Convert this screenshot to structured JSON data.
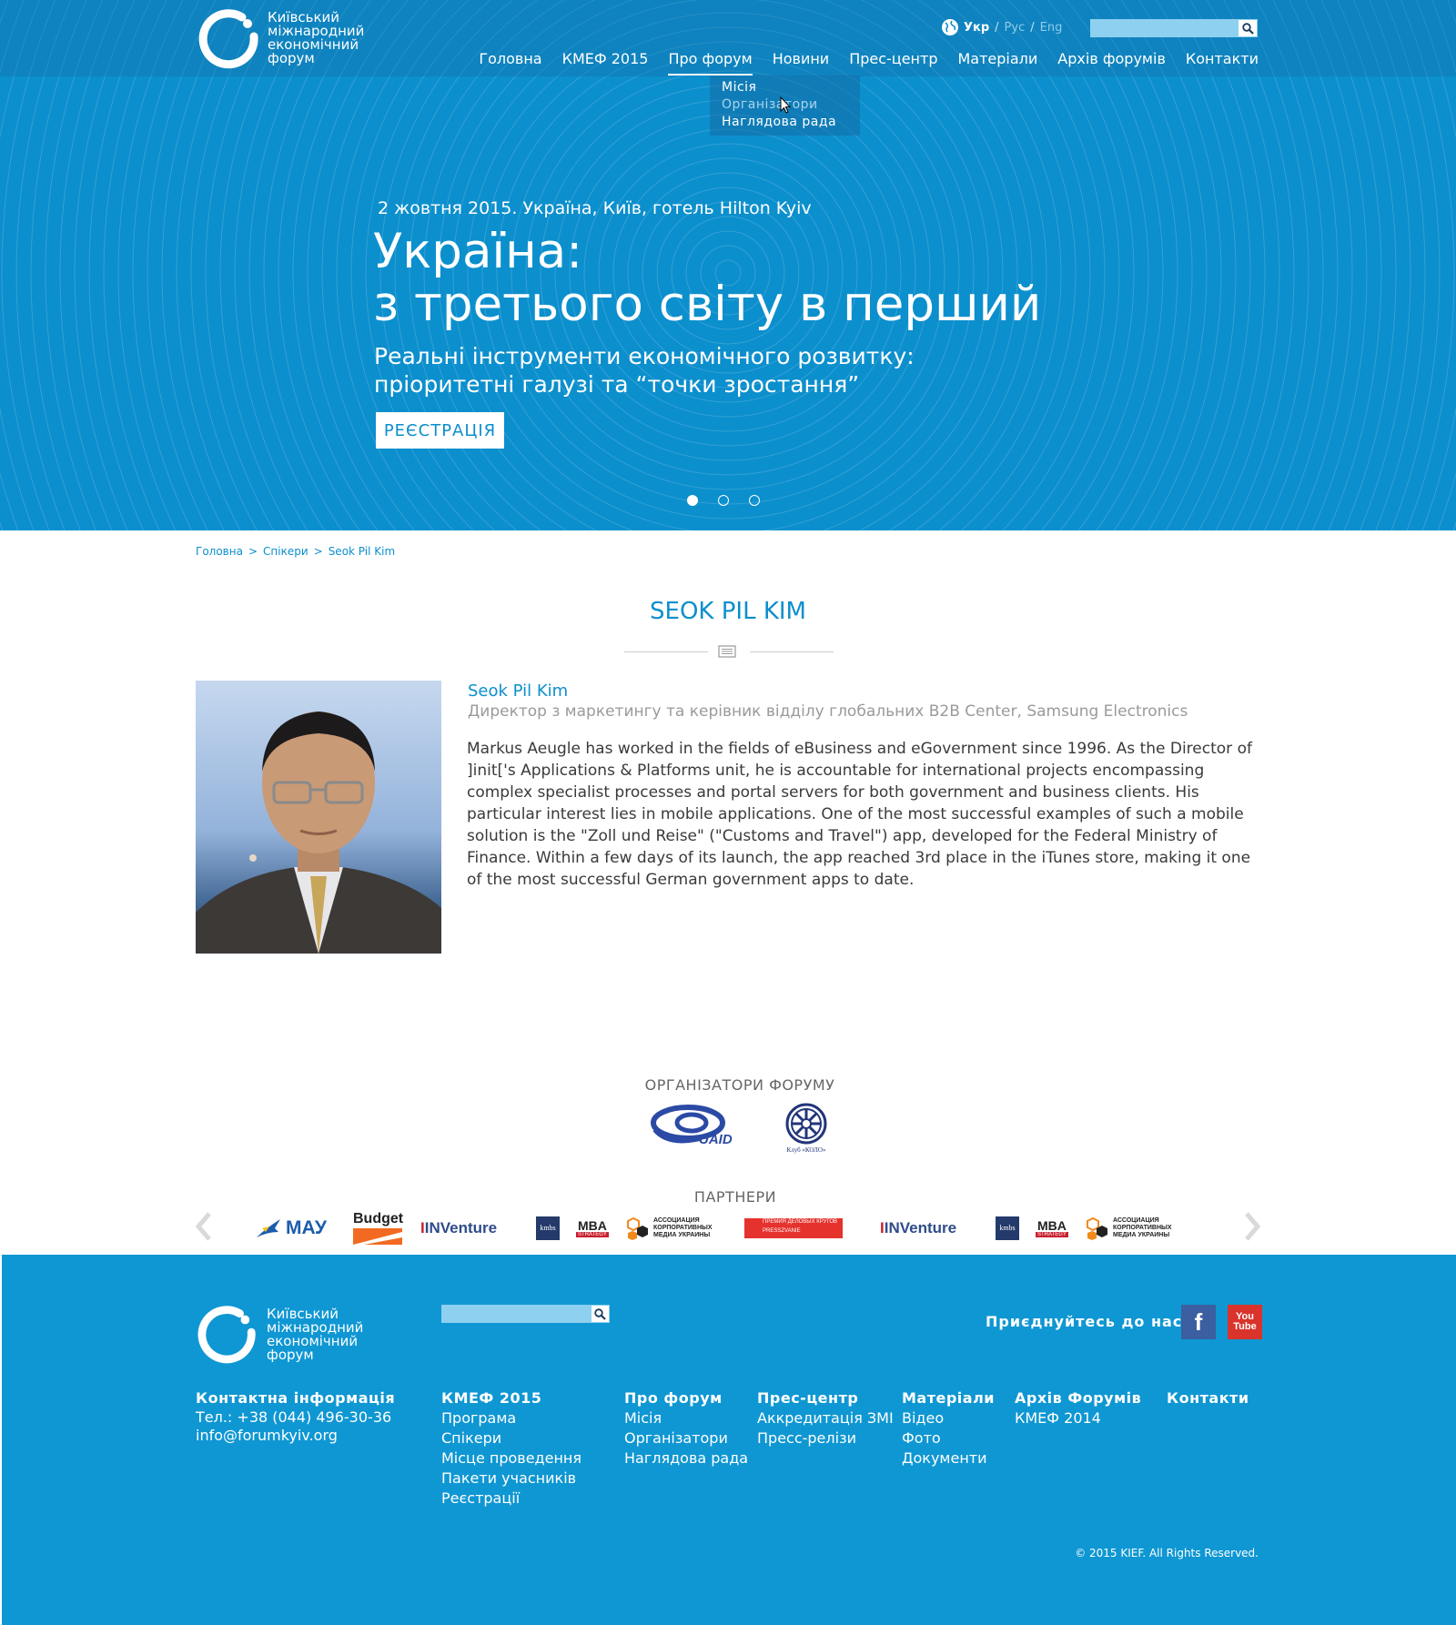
{
  "site": {
    "logo_lines": [
      "Київський",
      "міжнародний",
      "економічний",
      "форум"
    ]
  },
  "colors": {
    "brand": "#0c8fcd",
    "footer": "#0f97d3",
    "facebook": "#3b5fa0",
    "youtube": "#d9332b"
  },
  "header": {
    "languages": [
      "Укр",
      "Рус",
      "Eng"
    ],
    "active_language": "Укр",
    "search_placeholder": "",
    "nav": [
      "Головна",
      "КМЕФ 2015",
      "Про форум",
      "Новини",
      "Прес-центр",
      "Матеріали",
      "Архів форумів",
      "Контакти"
    ],
    "active_nav": "Про форум",
    "dropdown": [
      "Місія",
      "Організатори",
      "Наглядова рада"
    ]
  },
  "hero": {
    "date_line": "2 жовтня 2015. Україна, Київ, готель Hilton Kyiv",
    "title_lines": [
      "Україна:",
      "з третього світу в перший"
    ],
    "subtitle_lines": [
      "Реальні інструменти економічного розвитку:",
      "пріоритетні галузі та “точки зростання”"
    ],
    "register_label": "РЕЄСТРАЦІЯ",
    "slides_count": 3,
    "active_slide": 1
  },
  "breadcrumb": [
    "Головна",
    "Спікери",
    "Seok Pil Kim"
  ],
  "page_title": "SEOK PIL KIM",
  "speaker": {
    "name": "Seok Pil Kim",
    "role": "Директор з маркетингу та керівник відділу глобальних B2B Center, Samsung Electronics",
    "bio": "Markus Aeugle has worked in the fields of eBusiness and eGovernment since 1996. As the Director of ]init['s Applications & Platforms unit, he is accountable for international projects encompassing complex specialist processes and portal servers for both government and business clients. His particular interest lies in mobile applications. One of the most successful examples of such a mobile solution is the \"Zoll und Reise\" (\"Customs and Travel\") app, developed for the Federal Ministry of Finance. Within a few days of its launch, the app reached 3rd place in the iTunes store, making it one of the most successful German government apps to date."
  },
  "organizers": {
    "title": "ОРГАНІЗАТОРИ ФОРУМУ",
    "logos": [
      {
        "name": "UAID",
        "text": "UAID"
      },
      {
        "name": "Клуб КОЛО",
        "text": "Клуб «КОЛО»"
      }
    ]
  },
  "partners": {
    "title": "ПАРТНЕРИ",
    "logos": [
      {
        "id": "mau",
        "text": "МАУ"
      },
      {
        "id": "budget",
        "text": "Budget"
      },
      {
        "id": "inventure",
        "text": "INVenture"
      },
      {
        "id": "kmbs",
        "text": "kmbs"
      },
      {
        "id": "mba",
        "text": "MBA",
        "sub": "STRATEGY"
      },
      {
        "id": "akmu",
        "text": "АССОЦИАЦИЯ КОРПОРАТИВНЫХ МЕДИА УКРАИНЫ"
      },
      {
        "id": "premia",
        "text": "ПРЕМИЯ ДЕЛОВЫХ КРУГОВ",
        "sub": "PRESSZVANIE"
      },
      {
        "id": "inventure2",
        "text": "INVenture"
      },
      {
        "id": "kmbs2",
        "text": "kmbs"
      },
      {
        "id": "mba2",
        "text": "MBA",
        "sub": "STRATEGY"
      },
      {
        "id": "akmu2",
        "text": "АССОЦИАЦИЯ КОРПОРАТИВНЫХ МЕДИА УКРАИНЫ"
      }
    ]
  },
  "footer": {
    "join_label": "Приєднуйтесь до нас:",
    "social": {
      "facebook": "f",
      "youtube_top": "You",
      "youtube_bottom": "Tube"
    },
    "contact": {
      "heading": "Контактна  інформація",
      "phone": "Тел.: +38 (044) 496-30-36",
      "email": "info@forumkyiv.org"
    },
    "columns": [
      {
        "heading": "КМЕФ 2015",
        "links": [
          "Програма",
          "Спікери",
          "Місце проведення",
          "Пакети учасників",
          "Реєстрації"
        ]
      },
      {
        "heading": "Про форум",
        "links": [
          "Місія",
          "Організатори",
          "Наглядова рада"
        ]
      },
      {
        "heading": "Прес-центр",
        "links": [
          "Аккредитація ЗМІ",
          "Пресс-релізи"
        ]
      },
      {
        "heading": "Матеріали",
        "links": [
          "Відео",
          "Фото",
          "Документи"
        ]
      },
      {
        "heading": "Архів Форумів",
        "links": [
          "КМЕФ 2014"
        ]
      },
      {
        "heading": "Контакти",
        "links": []
      }
    ],
    "copyright": "© 2015 KIEF. All Rights Reserved."
  }
}
